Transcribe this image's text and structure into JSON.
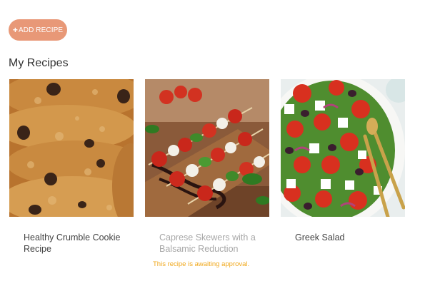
{
  "toolbar": {
    "add_label": "ADD RECIPE",
    "add_icon": "plus-icon"
  },
  "section": {
    "title": "My Recipes"
  },
  "recipes": [
    {
      "title": "Healthy Crumble Cookie Recipe",
      "image": "cookies-photo",
      "status": ""
    },
    {
      "title": "Caprese Skewers with a Balsamic Reduction",
      "image": "caprese-skewers-photo",
      "status": "This recipe is awaiting approval."
    },
    {
      "title": "Greek Salad",
      "image": "greek-salad-photo",
      "status": ""
    }
  ],
  "colors": {
    "accent": "#e89877",
    "pending_text": "#f0a81c",
    "muted_text": "#a7a7a7"
  }
}
